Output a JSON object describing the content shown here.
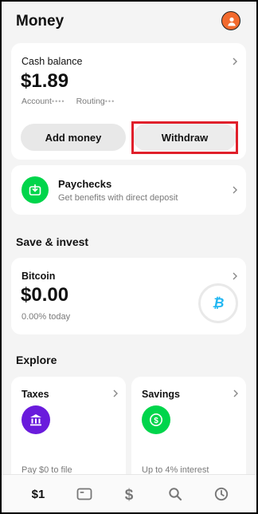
{
  "header": {
    "title": "Money"
  },
  "cash": {
    "title": "Cash balance",
    "amount": "$1.89",
    "account_label": "Account",
    "account_mask": "••••",
    "routing_label": "Routing",
    "routing_mask": "•••",
    "add_label": "Add money",
    "withdraw_label": "Withdraw"
  },
  "paychecks": {
    "title": "Paychecks",
    "subtitle": "Get benefits with direct deposit"
  },
  "save_invest": {
    "heading": "Save & invest",
    "bitcoin": {
      "title": "Bitcoin",
      "amount": "$0.00",
      "change": "0.00% today",
      "symbol": "₿"
    }
  },
  "explore": {
    "heading": "Explore",
    "taxes": {
      "title": "Taxes",
      "subtitle": "Pay $0 to file"
    },
    "savings": {
      "title": "Savings",
      "subtitle": "Up to 4% interest"
    }
  },
  "bottom_nav": {
    "balance": "$1",
    "items": [
      "balance",
      "card-icon",
      "dollar-icon",
      "search-icon",
      "clock-icon"
    ]
  },
  "colors": {
    "accent_green": "#00d54b",
    "avatar_orange": "#f26a2e",
    "taxes_purple": "#6a1bdc",
    "bitcoin_blue": "#1fb6f2",
    "highlight_red": "#e0202b"
  }
}
